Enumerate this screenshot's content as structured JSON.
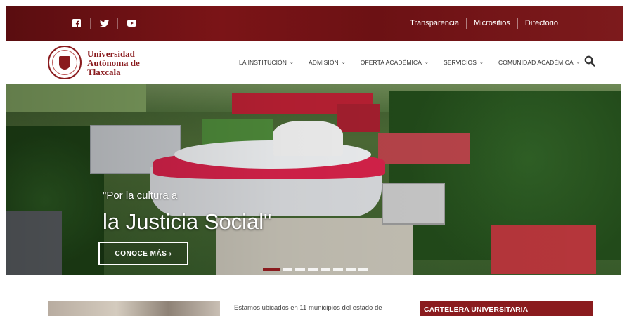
{
  "topbar": {
    "social": [
      "facebook-icon",
      "twitter-icon",
      "youtube-icon"
    ],
    "links": [
      "Transparencia",
      "Micrositios",
      "Directorio"
    ]
  },
  "header": {
    "logo_line1": "Universidad",
    "logo_line2": "Autónoma de",
    "logo_line3": "Tlaxcala",
    "nav": [
      {
        "label": "LA INSTITUCIÓN"
      },
      {
        "label": "ADMISIÓN"
      },
      {
        "label": "OFERTA ACADÉMICA"
      },
      {
        "label": "SERVICIOS"
      },
      {
        "label": "COMUNIDAD ACADÉMICA"
      }
    ]
  },
  "hero": {
    "slogan_line1": "\"Por la cultura a",
    "slogan_line2": "la Justicia Social\"",
    "cta": "CONOCE MÁS",
    "cta_arrow": "›",
    "slides": 8,
    "active_slide": 1
  },
  "content": {
    "intro": "Estamos ubicados en 11 municipios del estado de",
    "cartelera": "CARTELERA UNIVERSITARIA"
  },
  "colors": {
    "brand": "#8a1b1e",
    "topbar": "#6c1114"
  }
}
